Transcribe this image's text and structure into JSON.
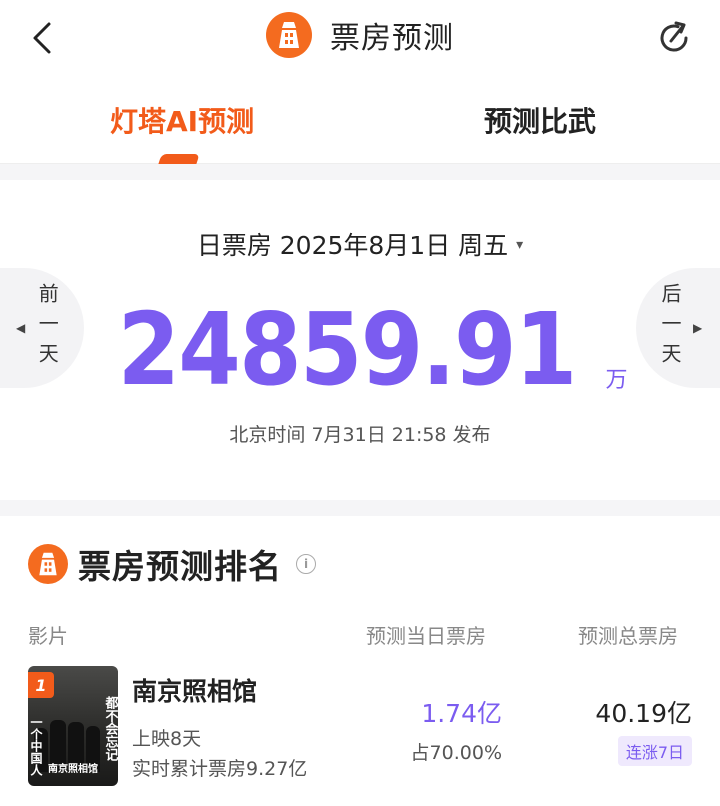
{
  "header": {
    "title": "票房预测",
    "back_icon": "chevron-left-icon",
    "share_icon": "refresh-share-icon",
    "logo_icon": "lighthouse-icon",
    "accent_color": "#f46b1f"
  },
  "tabs": [
    {
      "label": "灯塔AI预测",
      "active": true
    },
    {
      "label": "预测比武",
      "active": false
    }
  ],
  "hero": {
    "date_label": "日票房 2025年8月1日 周五",
    "dropdown_caret": "▾",
    "box_office_value": "24859.91",
    "unit": "万",
    "publish_time": "北京时间 7月31日 21:58 发布",
    "prev_day_label": "前一天",
    "next_day_label": "后一天",
    "prev_arrow": "◀",
    "next_arrow": "▶",
    "value_color": "#7b5cf0"
  },
  "ranking": {
    "title": "票房预测排名",
    "info_symbol": "i",
    "columns": [
      "影片",
      "预测当日票房",
      "预测总票房"
    ],
    "films": [
      {
        "rank": "1",
        "name": "南京照相馆",
        "days": "上映8天",
        "cumulative": "实时累计票房9.27亿",
        "daily_forecast": "1.74亿",
        "share": "占70.00%",
        "total_forecast": "40.19亿",
        "streak": "连涨7日",
        "poster_text_right": "都不会忘记",
        "poster_text_left": "一个中国人",
        "poster_title": "南京照相馆"
      }
    ]
  }
}
